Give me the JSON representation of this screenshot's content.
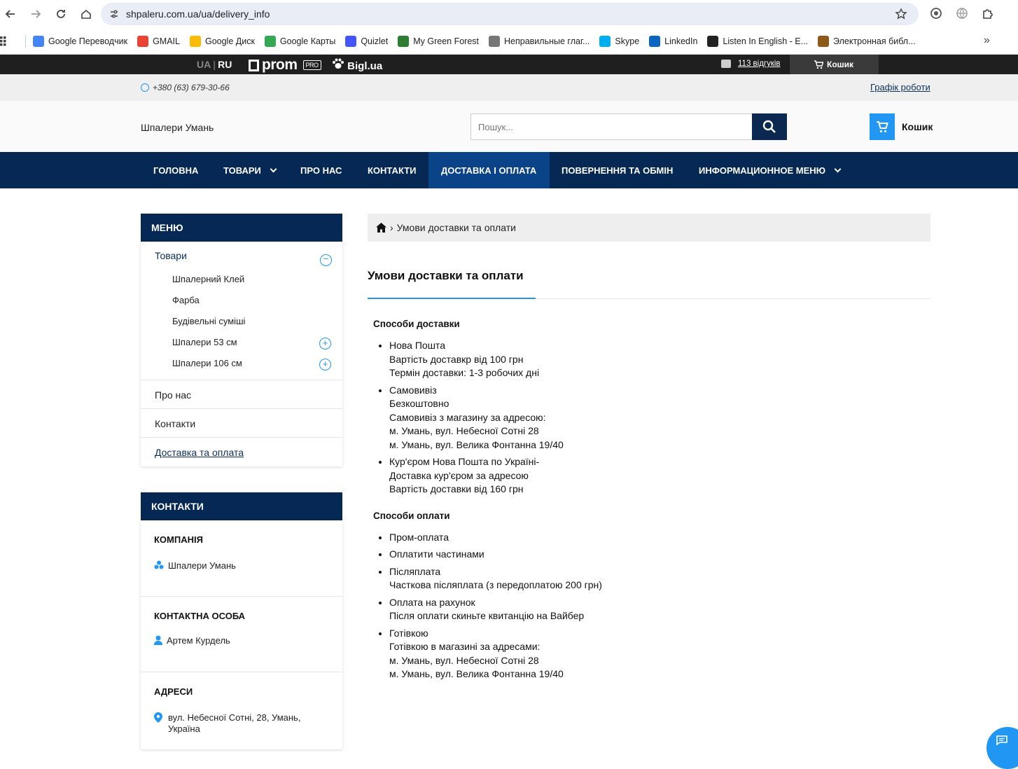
{
  "browser": {
    "url": "shpaleru.com.ua/ua/delivery_info",
    "bookmarks": [
      {
        "label": "Google Переводчик",
        "color": "#4285f4"
      },
      {
        "label": "GMAIL",
        "color": "#ea4335"
      },
      {
        "label": "Google Диск",
        "color": "#fbbc04"
      },
      {
        "label": "Google Карты",
        "color": "#34a853"
      },
      {
        "label": "Quizlet",
        "color": "#4255ff"
      },
      {
        "label": "My Green Forest",
        "color": "#2e7d32"
      },
      {
        "label": "Неправильные глаг...",
        "color": "#777"
      },
      {
        "label": "Skype",
        "color": "#00aff0"
      },
      {
        "label": "LinkedIn",
        "color": "#0a66c2"
      },
      {
        "label": "Listen In English - E...",
        "color": "#222"
      },
      {
        "label": "Электронная библ...",
        "color": "#8d5a1a"
      }
    ]
  },
  "prombar": {
    "lang_ua": "UA",
    "lang_ru": "RU",
    "prom": "prom",
    "pro": "PRO",
    "bigl": "Bigl.ua",
    "reviews": "113 відгуків",
    "cart": "Кошик"
  },
  "topinfo": {
    "phone": "+380 (63) 679-30-66",
    "schedule": "Графік роботи"
  },
  "header": {
    "shop_name": "Шпалери Умань",
    "search_placeholder": "Пошук...",
    "cart_label": "Кошик"
  },
  "nav": [
    "ГОЛОВНА",
    "ТОВАРИ",
    "ПРО НАС",
    "КОНТАКТИ",
    "ДОСТАВКА І ОПЛАТА",
    "ПОВЕРНЕННЯ ТА ОБМІН",
    "ИНФОРМАЦИОННОЕ МЕНЮ"
  ],
  "sidebar": {
    "menu_title": "МЕНЮ",
    "goods": "Товари",
    "sub_items": [
      "Шпалерний Клей",
      "Фарба",
      "Будівельні суміші",
      "Шпалери 53 см",
      "Шпалери 106 см"
    ],
    "about": "Про нас",
    "contacts": "Контакти",
    "delivery": "Доставка та оплата",
    "contacts_title": "КОНТАКТИ",
    "company_h": "КОМПАНІЯ",
    "company": "Шпалери Умань",
    "person_h": "КОНТАКТНА ОСОБА",
    "person": "Артем Курдель",
    "address_h": "АДРЕСИ",
    "address": "вул. Небесної Сотні, 28, Умань, Україна"
  },
  "breadcrumb": {
    "current": "Умови доставки та оплати"
  },
  "page": {
    "title": "Умови доставки та оплати",
    "delivery_h": "Способи доставки",
    "delivery": [
      [
        "Нова Пошта",
        "Вартість доставкр від 100 грн",
        "Термін доставки: 1-3 робочих дні"
      ],
      [
        "Самовивіз",
        "Безкоштовно",
        "Самовивіз з магазину за адресою:",
        "м. Умань, вул. Небесної Сотні 28",
        "м. Умань, вул. Велика Фонтанна 19/40"
      ],
      [
        "Кур'єром Нова Пошта по Україні-",
        "Доставка кур'єром за адресою",
        "Вартість доставки від 160 грн"
      ]
    ],
    "payment_h": "Способи оплати",
    "payment": [
      [
        "Пром-оплата"
      ],
      [
        "Оплатити частинами"
      ],
      [
        "Післяплата",
        "Часткова післяплата (з передоплатою 200 грн)"
      ],
      [
        "Оплата на рахунок",
        "Після оплати скиньте квитанцію на Вайбер"
      ],
      [
        "Готівкою",
        "Готівкою в магазині за адресами:",
        "м. Умань, вул. Небесної Сотні 28",
        "м. Умань, вул. Велика Фонтанна 19/40"
      ]
    ]
  },
  "colors": {
    "brand": "#052855",
    "accent": "#2196f3"
  }
}
